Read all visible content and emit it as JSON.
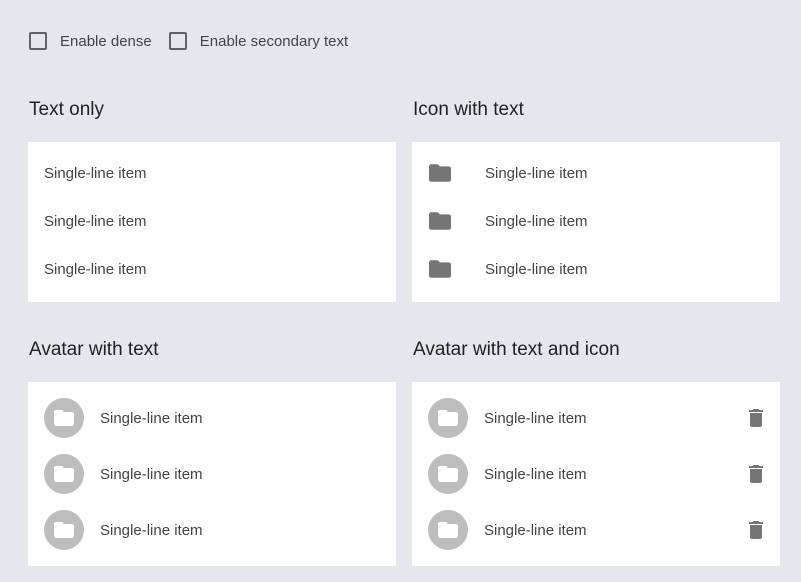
{
  "options": {
    "dense_label": "Enable dense",
    "secondary_label": "Enable secondary text"
  },
  "sections": {
    "text_only": {
      "title": "Text only",
      "items": [
        "Single-line item",
        "Single-line item",
        "Single-line item"
      ]
    },
    "icon_with_text": {
      "title": "Icon with text",
      "icon": "folder-icon",
      "items": [
        "Single-line item",
        "Single-line item",
        "Single-line item"
      ]
    },
    "avatar_with_text": {
      "title": "Avatar with text",
      "icon": "folder-icon",
      "items": [
        "Single-line item",
        "Single-line item",
        "Single-line item"
      ]
    },
    "avatar_with_text_and_icon": {
      "title": "Avatar with text and icon",
      "icon": "folder-icon",
      "action_icon": "delete-icon",
      "items": [
        "Single-line item",
        "Single-line item",
        "Single-line item"
      ]
    }
  },
  "colors": {
    "background": "#e4e8ec",
    "card": "#ffffff",
    "icon": "#757575",
    "avatar": "#bdbdbd"
  }
}
